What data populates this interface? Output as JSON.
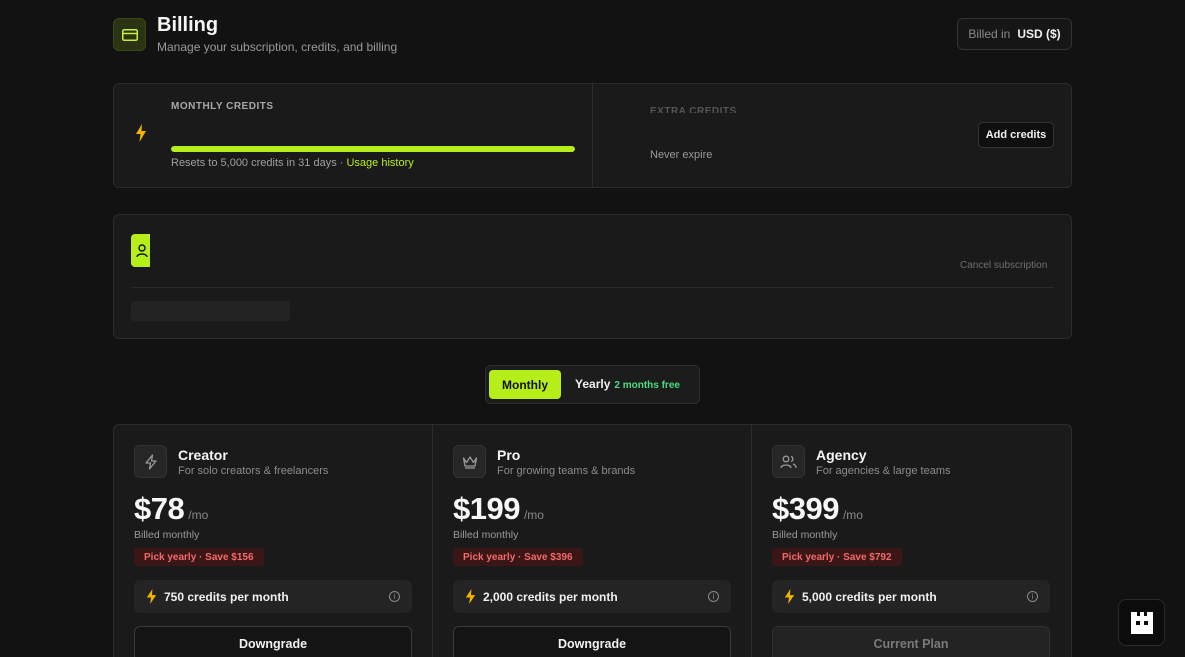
{
  "header": {
    "title": "Billing",
    "subtitle": "Manage your subscription, credits, and billing",
    "currency_label": "Billed in",
    "currency_value": "USD ($)",
    "icon": "credit-card-icon"
  },
  "credits": {
    "monthly_label": "MONTHLY CREDITS",
    "progress_fraction": 1.0,
    "reset_text": "Resets to 5,000 credits in 31 days · ",
    "usage_link": "Usage history",
    "extra_label": "EXTRA CREDITS",
    "extra_note": "Never expire",
    "add_button": "Add credits"
  },
  "subscription": {
    "cancel_label": "Cancel subscription",
    "icon": "user-icon"
  },
  "billing_toggle": {
    "monthly": "Monthly",
    "yearly": "Yearly",
    "yearly_badge": "2 months free",
    "selected": "monthly"
  },
  "plans": [
    {
      "name": "Creator",
      "desc": "For solo creators & freelancers",
      "price": "$78",
      "per": "/mo",
      "billed": "Billed monthly",
      "save": "Pick yearly · Save $156",
      "credits": "750 credits per month",
      "button": "Downgrade",
      "icon": "bolt-icon"
    },
    {
      "name": "Pro",
      "desc": "For growing teams & brands",
      "price": "$199",
      "per": "/mo",
      "billed": "Billed monthly",
      "save": "Pick yearly · Save $396",
      "credits": "2,000 credits per month",
      "button": "Downgrade",
      "icon": "crown-icon"
    },
    {
      "name": "Agency",
      "desc": "For agencies & large teams",
      "price": "$399",
      "per": "/mo",
      "billed": "Billed monthly",
      "save": "Pick yearly · Save $792",
      "credits": "5,000 credits per month",
      "button": "Current Plan",
      "icon": "users-icon"
    }
  ],
  "colors": {
    "accent": "#b6ee1a",
    "background": "#121212",
    "card": "#1a1a1a",
    "save_text": "#f26a6a",
    "badge_green": "#4ade80"
  }
}
